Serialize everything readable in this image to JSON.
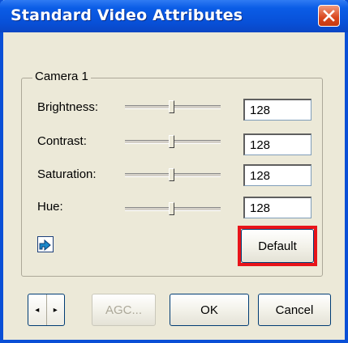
{
  "window": {
    "title": "Standard Video Attributes",
    "close_icon": "close-icon"
  },
  "group": {
    "label": "Camera 1"
  },
  "rows": [
    {
      "label": "Brightness:",
      "value": "128"
    },
    {
      "label": "Contrast:",
      "value": "128"
    },
    {
      "label": "Saturation:",
      "value": "128"
    },
    {
      "label": "Hue:",
      "value": "128"
    }
  ],
  "buttons": {
    "default": "Default",
    "agc": "AGC...",
    "ok": "OK",
    "cancel": "Cancel"
  },
  "nav": {
    "prev_glyph": "◂",
    "next_glyph": "▸"
  },
  "colors": {
    "titlebar": "#0a5ce6",
    "close": "#d9461c",
    "highlight": "#e8141a",
    "dialog_bg": "#ece9d8"
  }
}
